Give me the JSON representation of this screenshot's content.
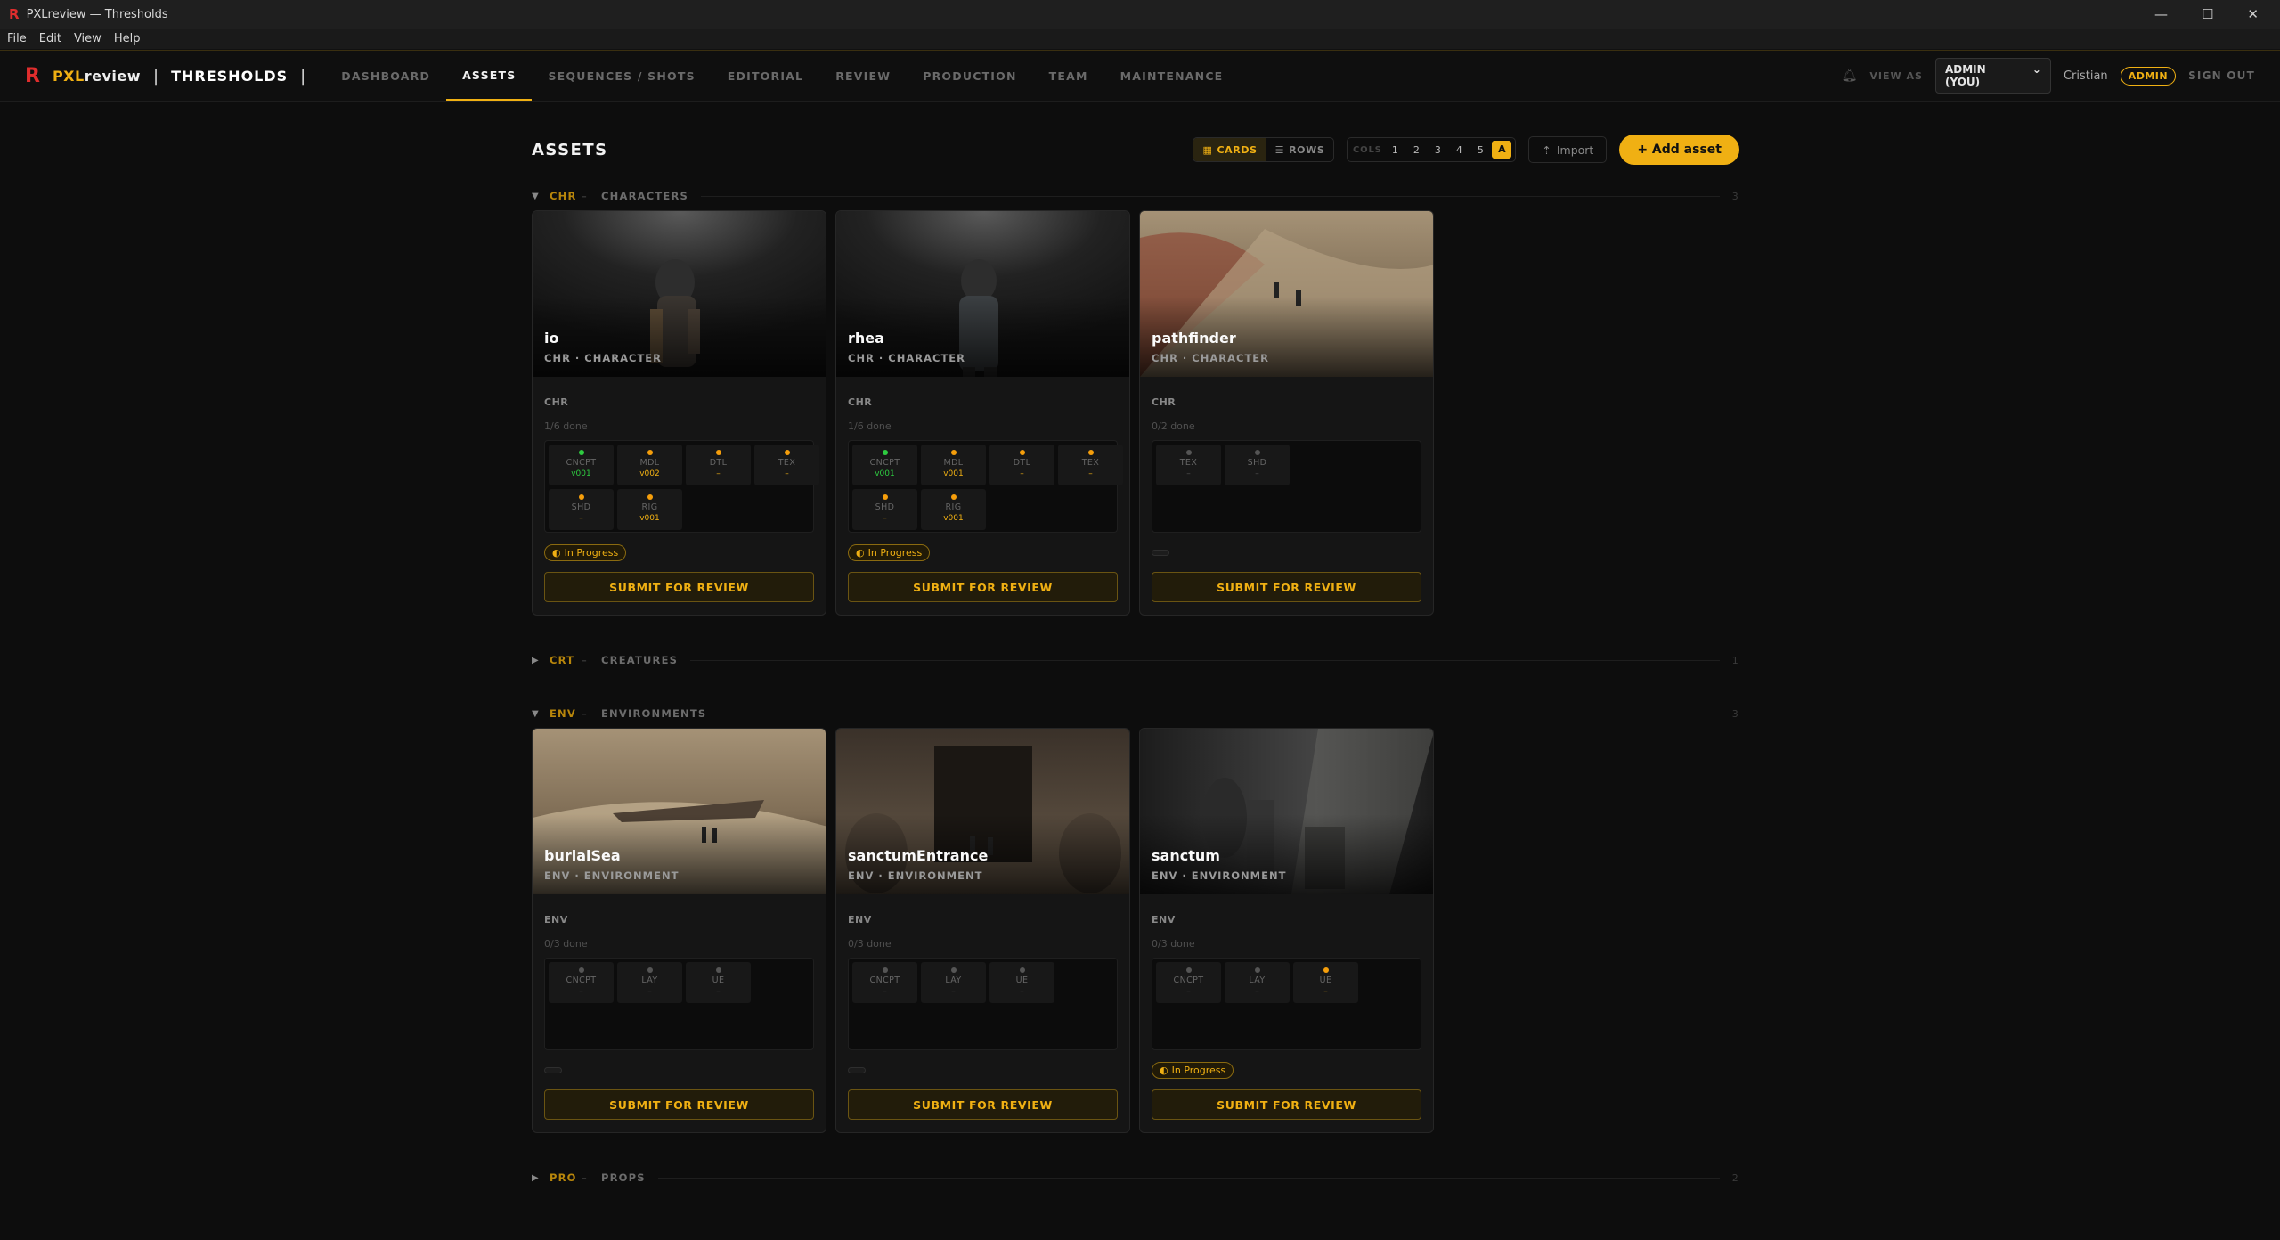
{
  "window": {
    "title": "PXLreview — Thresholds",
    "controls": [
      "—",
      "☐",
      "✕"
    ]
  },
  "menu": [
    "File",
    "Edit",
    "View",
    "Help"
  ],
  "nav": {
    "brand_px": "PXL",
    "brand_rest": "review",
    "divider": "|",
    "project": "THRESHOLDS",
    "tabs": [
      "DASHBOARD",
      "ASSETS",
      "SEQUENCES / SHOTS",
      "EDITORIAL",
      "REVIEW",
      "PRODUCTION",
      "TEAM",
      "MAINTENANCE"
    ],
    "active_tab": "ASSETS",
    "view_as_label": "VIEW AS",
    "view_as_value": "ADMIN (YOU)",
    "user": "Cristian",
    "role": "ADMIN",
    "sign_out": "SIGN OUT"
  },
  "page": {
    "title": "ASSETS",
    "view_cards": "CARDS",
    "view_rows": "ROWS",
    "cols_label": "COLS",
    "cols": [
      "1",
      "2",
      "3",
      "4",
      "5",
      "A"
    ],
    "cols_selected": "A",
    "import": "Import",
    "add": "+ Add asset"
  },
  "sections": [
    {
      "code": "CHR",
      "name": "CHARACTERS",
      "count": "3",
      "expanded": true,
      "arrow": "▼",
      "cards": [
        {
          "name": "io",
          "sub": "CHR · CHARACTER",
          "code": "CHR",
          "done": "1/6 done",
          "status": "In Progress",
          "tasks": [
            {
              "l": "CNCPT",
              "v": "v001",
              "c": "green"
            },
            {
              "l": "MDL",
              "v": "v002",
              "c": "orange"
            },
            {
              "l": "DTL",
              "v": "–",
              "c": "orange"
            },
            {
              "l": "TEX",
              "v": "–",
              "c": "orange"
            },
            {
              "l": "SHD",
              "v": "–",
              "c": "orange"
            },
            {
              "l": "RIG",
              "v": "v001",
              "c": "orange"
            }
          ]
        },
        {
          "name": "rhea",
          "sub": "CHR · CHARACTER",
          "code": "CHR",
          "done": "1/6 done",
          "status": "In Progress",
          "tasks": [
            {
              "l": "CNCPT",
              "v": "v001",
              "c": "green"
            },
            {
              "l": "MDL",
              "v": "v001",
              "c": "orange"
            },
            {
              "l": "DTL",
              "v": "–",
              "c": "orange"
            },
            {
              "l": "TEX",
              "v": "–",
              "c": "orange"
            },
            {
              "l": "SHD",
              "v": "–",
              "c": "orange"
            },
            {
              "l": "RIG",
              "v": "v001",
              "c": "orange"
            }
          ]
        },
        {
          "name": "pathfinder",
          "sub": "CHR · CHARACTER",
          "code": "CHR",
          "done": "0/2 done",
          "status": "",
          "tasks": [
            {
              "l": "TEX",
              "v": "–",
              "c": ""
            },
            {
              "l": "SHD",
              "v": "–",
              "c": ""
            }
          ]
        }
      ]
    },
    {
      "code": "CRT",
      "name": "CREATURES",
      "count": "1",
      "expanded": false,
      "arrow": "▶",
      "cards": []
    },
    {
      "code": "ENV",
      "name": "ENVIRONMENTS",
      "count": "3",
      "expanded": true,
      "arrow": "▼",
      "cards": [
        {
          "name": "burialSea",
          "sub": "ENV · ENVIRONMENT",
          "code": "ENV",
          "done": "0/3 done",
          "status": "",
          "tasks": [
            {
              "l": "CNCPT",
              "v": "–",
              "c": ""
            },
            {
              "l": "LAY",
              "v": "–",
              "c": ""
            },
            {
              "l": "UE",
              "v": "–",
              "c": ""
            }
          ]
        },
        {
          "name": "sanctumEntrance",
          "sub": "ENV · ENVIRONMENT",
          "code": "ENV",
          "done": "0/3 done",
          "status": "",
          "tasks": [
            {
              "l": "CNCPT",
              "v": "–",
              "c": ""
            },
            {
              "l": "LAY",
              "v": "–",
              "c": ""
            },
            {
              "l": "UE",
              "v": "–",
              "c": ""
            }
          ]
        },
        {
          "name": "sanctum",
          "sub": "ENV · ENVIRONMENT",
          "code": "ENV",
          "done": "0/3 done",
          "status": "In Progress",
          "tasks": [
            {
              "l": "CNCPT",
              "v": "–",
              "c": ""
            },
            {
              "l": "LAY",
              "v": "–",
              "c": ""
            },
            {
              "l": "UE",
              "v": "–",
              "c": "orange"
            }
          ]
        }
      ]
    },
    {
      "code": "PRO",
      "name": "PROPS",
      "count": "2",
      "expanded": false,
      "arrow": "▶",
      "cards": []
    }
  ],
  "submit_label": "SUBMIT FOR REVIEW",
  "colors": {
    "accent": "#f0b013",
    "brand_red": "#e02d2d",
    "done_green": "#2ecc40",
    "pending_orange": "#f59e0b"
  }
}
